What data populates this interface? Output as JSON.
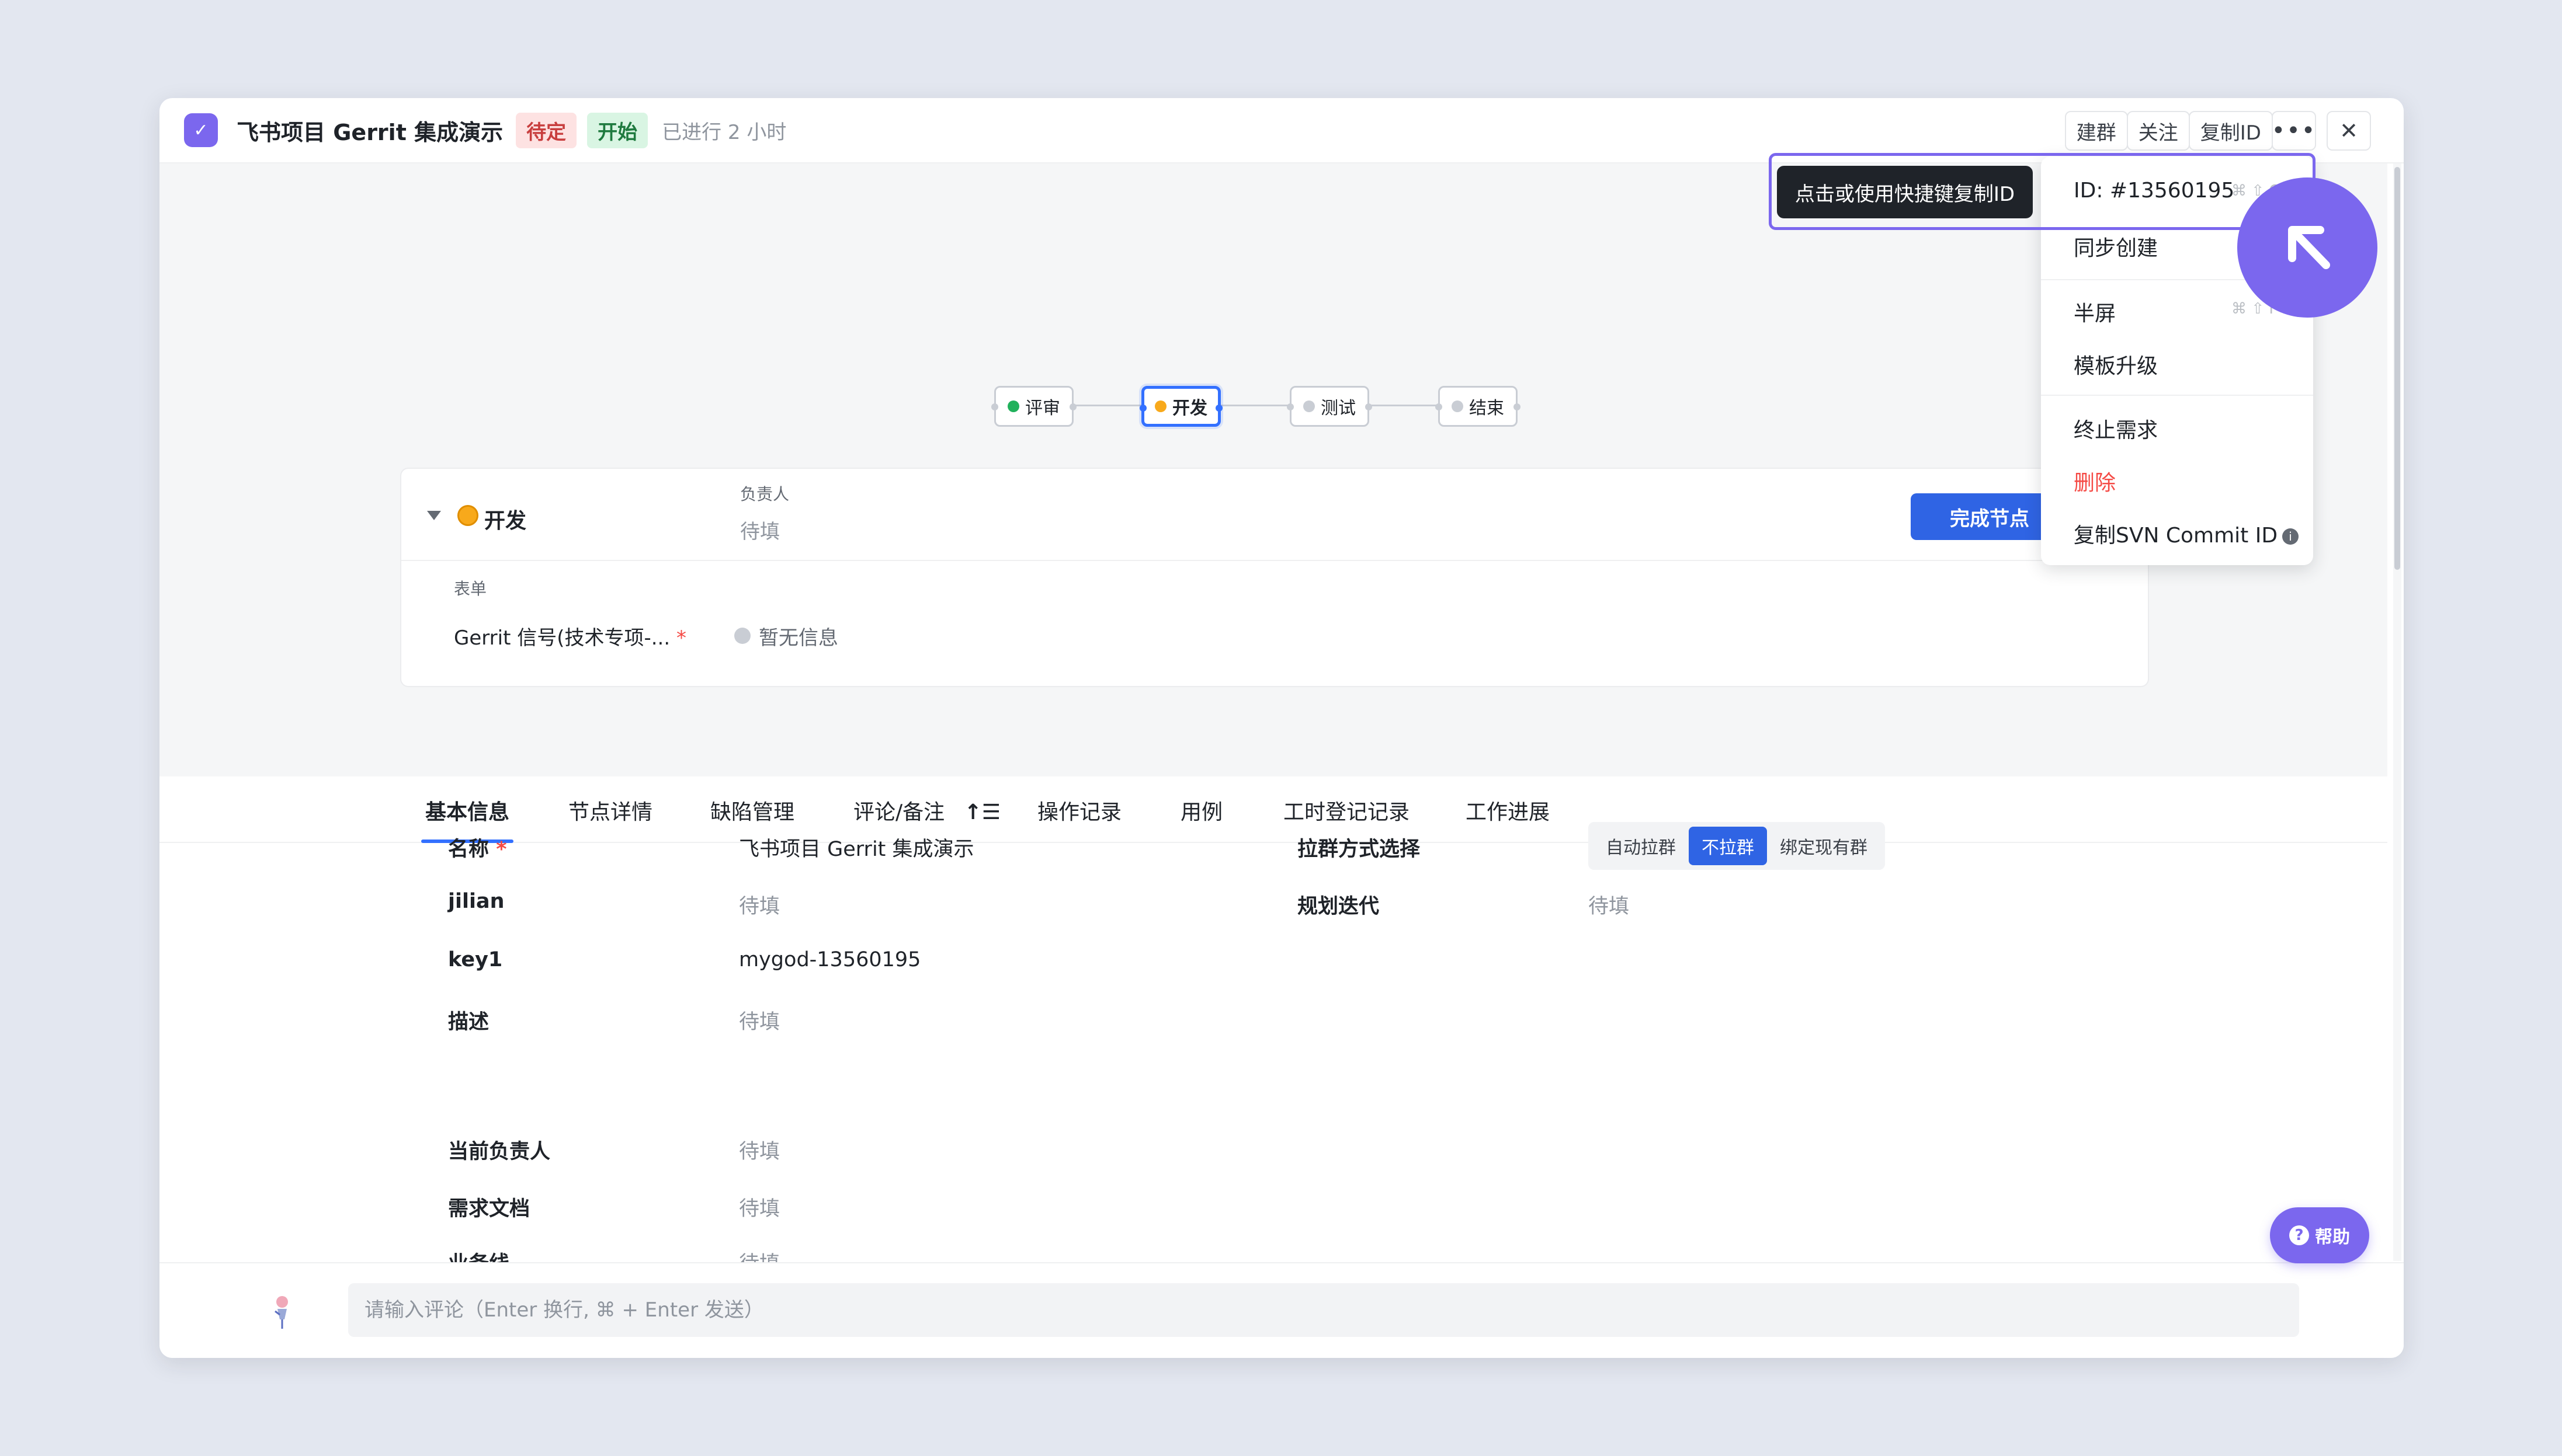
{
  "header": {
    "title": "飞书项目 Gerrit 集成演示",
    "tags": [
      "待定",
      "开始"
    ],
    "elapsed": "已进行 2 小时",
    "actions": {
      "build_group": "建群",
      "follow": "关注",
      "copy_id": "复制ID",
      "more": "•••",
      "close": "✕"
    }
  },
  "workflow": {
    "nodes": [
      {
        "label": "评审",
        "color": "#20b15b"
      },
      {
        "label": "开发",
        "color": "#f8a91b"
      },
      {
        "label": "测试",
        "color": "#c9cdd4"
      },
      {
        "label": "结束",
        "color": "#c9cdd4"
      }
    ]
  },
  "node_card": {
    "node_name": "开发",
    "owner_label": "负责人",
    "owner_value": "待填",
    "complete_button": "完成节点",
    "form_label": "表单",
    "field_name": "Gerrit 信号(技术专项-...",
    "required_mark": "*",
    "field_value": "暂无信息"
  },
  "tabs": [
    "基本信息",
    "节点详情",
    "缺陷管理",
    "评论/备注",
    "操作记录",
    "用例",
    "工时登记记录",
    "工作进展"
  ],
  "basic_info": {
    "left": [
      {
        "label": "名称",
        "required": "*",
        "value": "飞书项目 Gerrit 集成演示"
      },
      {
        "label": "jilian",
        "value": "待填"
      },
      {
        "label": "key1",
        "value": "mygod-13560195"
      },
      {
        "label": "描述",
        "value": "待填"
      },
      {
        "label": "当前负责人",
        "value": "待填"
      },
      {
        "label": "需求文档",
        "value": "待填"
      },
      {
        "label": "业务线",
        "value": "待填"
      }
    ],
    "right": [
      {
        "label": "拉群方式选择",
        "options": [
          "自动拉群",
          "不拉群",
          "绑定现有群"
        ],
        "selected": "不拉群"
      },
      {
        "label": "规划迭代",
        "value": "待填"
      }
    ]
  },
  "comment": {
    "placeholder": "请输入评论（Enter 换行, ⌘ + Enter 发送）"
  },
  "help": {
    "label": "帮助",
    "icon": "?"
  },
  "menu": {
    "id": "ID: #13560195",
    "id_shortcut": "⌘ ⇧ C",
    "sync_create": "同步创建",
    "half_screen": "半屏",
    "half_shortcut": "⌘ ⇧ F",
    "template_upgrade": "模板升级",
    "terminate": "终止需求",
    "delete": "删除",
    "copy_svn": "复制SVN Commit ID",
    "info_icon": "i"
  },
  "tooltip": "点击或使用快捷键复制ID",
  "colors": {
    "accent": "#3370ff",
    "brand": "#7b67ee",
    "danger": "#f54a45"
  }
}
